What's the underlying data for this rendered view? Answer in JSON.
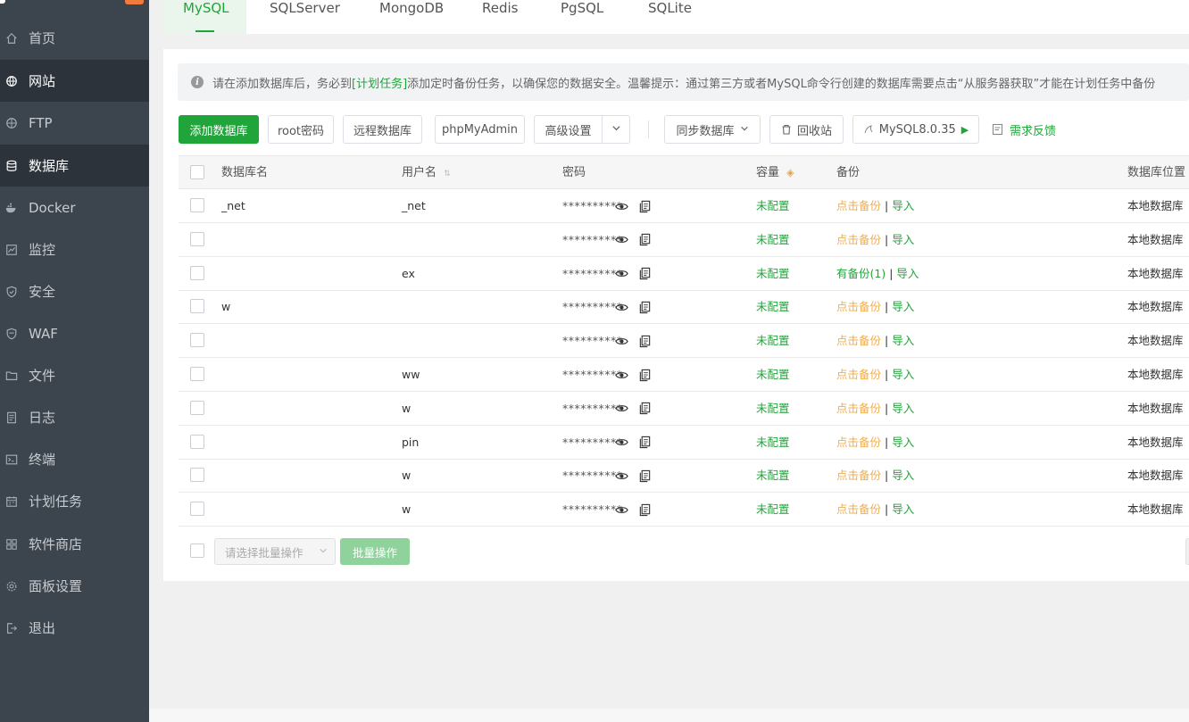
{
  "sidebar": {
    "items": [
      {
        "label": "首页",
        "icon": "home-icon"
      },
      {
        "label": "网站",
        "icon": "globe-icon"
      },
      {
        "label": "FTP",
        "icon": "ftp-globe-icon"
      },
      {
        "label": "数据库",
        "icon": "database-icon"
      },
      {
        "label": "Docker",
        "icon": "docker-icon"
      },
      {
        "label": "监控",
        "icon": "monitor-chart-icon"
      },
      {
        "label": "安全",
        "icon": "shield-icon"
      },
      {
        "label": "WAF",
        "icon": "waf-shield-icon"
      },
      {
        "label": "文件",
        "icon": "folder-icon"
      },
      {
        "label": "日志",
        "icon": "log-icon"
      },
      {
        "label": "终端",
        "icon": "terminal-icon"
      },
      {
        "label": "计划任务",
        "icon": "calendar-icon"
      },
      {
        "label": "软件商店",
        "icon": "app-grid-icon"
      },
      {
        "label": "面板设置",
        "icon": "settings-gear-icon"
      },
      {
        "label": "退出",
        "icon": "logout-icon"
      }
    ],
    "active": [
      "网站",
      "数据库"
    ]
  },
  "tabs": [
    "MySQL",
    "SQLServer",
    "MongoDB",
    "Redis",
    "PgSQL",
    "SQLite"
  ],
  "tip": {
    "before": "请在添加数据库后，务必到",
    "link": "[计划任务]",
    "after": "添加定时备份任务，以确保您的数据安全。温馨提示：通过第三方或者MySQL命令行创建的数据库需要点击“从服务器获取”才能在计划任务中备份"
  },
  "toolbar": {
    "add_db": "添加数据库",
    "root_pwd": "root密码",
    "remote_db": "远程数据库",
    "phpmyadmin": "phpMyAdmin",
    "advanced": "高级设置",
    "sync_db": "同步数据库",
    "recycle": "回收站",
    "mysql_version": "MySQL8.0.35",
    "feedback": "需求反馈"
  },
  "table": {
    "headers": {
      "db_name": "数据库名",
      "username": "用户名",
      "password": "密码",
      "capacity": "容量",
      "backup": "备份",
      "location": "数据库位置"
    },
    "rows": [
      {
        "name": "_net",
        "user": "_net",
        "password": "**********",
        "capacity": "未配置",
        "backup": "点击备份",
        "backup_type": "none",
        "import": "导入",
        "location": "本地数据库"
      },
      {
        "name": "",
        "user": "",
        "password": "**********",
        "capacity": "未配置",
        "backup": "点击备份",
        "backup_type": "none",
        "import": "导入",
        "location": "本地数据库"
      },
      {
        "name": "",
        "user": "ex",
        "password": "**********",
        "capacity": "未配置",
        "backup": "有备份(1)",
        "backup_type": "has",
        "import": "导入",
        "location": "本地数据库"
      },
      {
        "name": "w",
        "user": "",
        "password": "**********",
        "capacity": "未配置",
        "backup": "点击备份",
        "backup_type": "none",
        "import": "导入",
        "location": "本地数据库"
      },
      {
        "name": "",
        "user": "",
        "password": "**********",
        "capacity": "未配置",
        "backup": "点击备份",
        "backup_type": "none",
        "import": "导入",
        "location": "本地数据库"
      },
      {
        "name": "",
        "user": "ww",
        "password": "**********",
        "capacity": "未配置",
        "backup": "点击备份",
        "backup_type": "none",
        "import": "导入",
        "location": "本地数据库"
      },
      {
        "name": "",
        "user": "w",
        "password": "**********",
        "capacity": "未配置",
        "backup": "点击备份",
        "backup_type": "none",
        "import": "导入",
        "location": "本地数据库"
      },
      {
        "name": "",
        "user": "pin",
        "password": "**********",
        "capacity": "未配置",
        "backup": "点击备份",
        "backup_type": "none",
        "import": "导入",
        "location": "本地数据库"
      },
      {
        "name": "",
        "user": "w",
        "password": "**********",
        "capacity": "未配置",
        "backup": "点击备份",
        "backup_type": "none",
        "import": "导入",
        "location": "本地数据库"
      },
      {
        "name": "",
        "user": "w",
        "password": "**********",
        "capacity": "未配置",
        "backup": "点击备份",
        "backup_type": "none",
        "import": "导入",
        "location": "本地数据库"
      }
    ],
    "separator": "|"
  },
  "batch": {
    "placeholder": "请选择批量操作",
    "button": "批量操作",
    "prev": "<"
  },
  "colors": {
    "accent": "#20a53a",
    "warning": "#f0ad4e",
    "sidebar_bg": "#3c444d",
    "sidebar_active": "#2d333a"
  }
}
